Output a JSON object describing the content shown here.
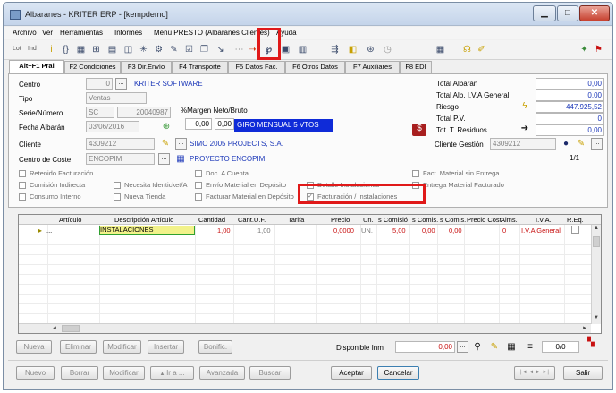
{
  "window": {
    "title": "Albaranes - KRITER ERP - [kempdemo]",
    "minimize_icon": "minimize-icon",
    "maximize_icon": "maximize-icon",
    "close_icon": "close-icon"
  },
  "menu": [
    "Archivo",
    "Ver",
    "Herramientas",
    "Informes",
    "Menú PRESTO (Albaranes Clientes)",
    "Ayuda"
  ],
  "toolbar": {
    "lot_label": "Lot",
    "ind_label": "Ind",
    "icons": [
      "info-icon",
      "braces-icon",
      "grid-icon",
      "tree-icon",
      "document-icon",
      "preview-icon",
      "asterisk-icon",
      "gear-icon",
      "tools-icon",
      "checklist-icon",
      "copy-icon",
      "tag-icon",
      "link-icon",
      "presto-icon",
      "window-icon",
      "table-icon",
      "filter-icon",
      "export-icon",
      "palette-icon",
      "circle-icon",
      "calculator-icon",
      "book-icon",
      "flag-icon",
      "clip-icon"
    ]
  },
  "tabs": [
    "Alt+F1 Pral",
    "F2 Condiciones",
    "F3 Dir.Envío",
    "F4 Transporte",
    "F5 Datos Fac.",
    "F6 Otros Datos",
    "F7 Auxiliares",
    "F8 EDI"
  ],
  "form": {
    "centro_label": "Centro",
    "centro_value": "0",
    "centro_name": "KRITER SOFTWARE",
    "tipo_label": "Tipo",
    "tipo_value": "Ventas",
    "serie_label": "Serie/Número",
    "serie_value": "SC",
    "numero_value": "20040987",
    "margen_label": "%Margen Neto/Bruto",
    "margen_neto": "0,00",
    "margen_bruto": "0,00",
    "forma_pago": "GIRO MENSUAL 5 VTOS",
    "fecha_label": "Fecha Albarán",
    "fecha_value": "03/06/2016",
    "cliente_label": "Cliente",
    "cliente_value": "4309212",
    "cliente_name": "SIMO 2005 PROJECTS, S.A.",
    "coste_label": "Centro de Coste",
    "coste_value": "ENCOPIM",
    "proyecto_name": "PROYECTO ENCOPIM",
    "dots_label": "..."
  },
  "totals": {
    "total_albaran_label": "Total Albarán",
    "total_albaran_value": "0,00",
    "total_iva_label": "Total Alb. I.V.A General",
    "total_iva_value": "0,00",
    "riesgo_label": "Riesgo",
    "riesgo_value": "447.925,52",
    "total_pv_label": "Total P.V.",
    "total_pv_value": "0",
    "residuos_label": "Tot. T. Residuos",
    "residuos_value": "0,00",
    "gestion_label": "Cliente Gestión",
    "gestion_value": "4309212",
    "page_counter": "1/1"
  },
  "checkboxes": [
    "Retenido Facturación",
    "Doc. A Cuenta",
    "Fact. Material sin Entrega",
    "Comisión Indirecta",
    "Necesita Identicket/A",
    "Envío Material en Depósito",
    "Detalle Instalaciones",
    "Entrega Material Facturado",
    "Consumo Interno",
    "Nueva Tienda",
    "Facturar Material en Depósito",
    "Facturación / Instalaciones"
  ],
  "grid": {
    "columns": [
      "Artículo",
      "Descripción Artículo",
      "Cantidad",
      "Cant.U.F.",
      "Tarifa",
      "Precio",
      "Un.",
      "s Comisió",
      "s Comis.",
      "s Comis.",
      "Precio Cost",
      "Alms.",
      "I.V.A.",
      "R.Eq."
    ],
    "rows": [
      {
        "marker": "►",
        "articulo": "...",
        "descripcion": "INSTALACIONES",
        "cantidad": "1,00",
        "cant_uf": "1,00",
        "tarifa": "",
        "precio": "0,0000",
        "un": "UN.",
        "comision1": "5,00",
        "comision2": "0,00",
        "comision3": "0,00",
        "precio_coste": "",
        "alms": "0",
        "iva": "I.V.A General"
      }
    ]
  },
  "line_buttons": [
    "Nueva",
    "Eliminar",
    "Modificar",
    "Insertar",
    "Bonific."
  ],
  "disponible": {
    "label": "Disponible Inm",
    "value": "0,00",
    "counter": "0/0"
  },
  "bottom_buttons": {
    "nuevo": "Nuevo",
    "borrar": "Borrar",
    "modificar": "Modificar",
    "ir_a": "Ir a ...",
    "avanzada": "Avanzada",
    "buscar": "Buscar",
    "aceptar": "Aceptar",
    "cancelar": "Cancelar",
    "salir": "Salir",
    "nav": [
      "|◄",
      "◄",
      "►",
      "►|"
    ]
  },
  "colors": {
    "highlight_red": "#e01919",
    "yellow_cell": "#f2f28a",
    "blue_field": "#0f2bd8",
    "link_blue": "#1a36b8",
    "value_blue": "#1a36b8",
    "iva_red": "#c81010"
  }
}
